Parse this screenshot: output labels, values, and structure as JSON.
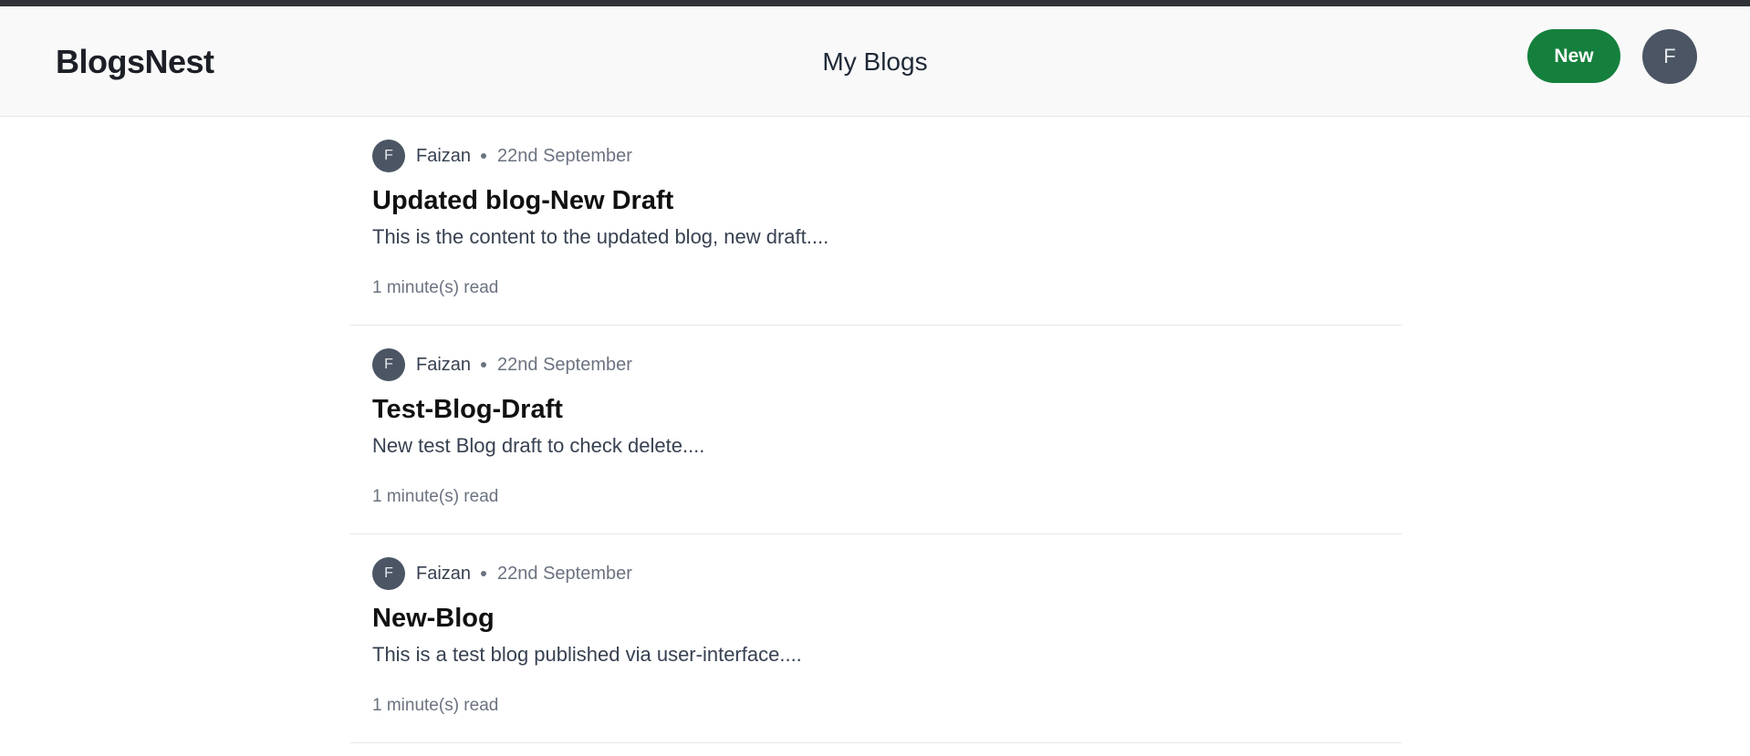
{
  "header": {
    "brand": "BlogsNest",
    "title": "My Blogs",
    "new_button_label": "New",
    "user_initial": "F"
  },
  "colors": {
    "accent_green": "#15803d",
    "avatar_gray": "#4b5563",
    "top_strip": "#2f3237"
  },
  "posts": [
    {
      "author_initial": "F",
      "author": "Faizan",
      "date": "22nd September",
      "title": "Updated blog-New Draft",
      "excerpt": "This is the content to the updated blog, new draft....",
      "read_time": "1 minute(s) read"
    },
    {
      "author_initial": "F",
      "author": "Faizan",
      "date": "22nd September",
      "title": "Test-Blog-Draft",
      "excerpt": "New test Blog draft to check delete....",
      "read_time": "1 minute(s) read"
    },
    {
      "author_initial": "F",
      "author": "Faizan",
      "date": "22nd September",
      "title": "New-Blog",
      "excerpt": "This is a test blog published via user-interface....",
      "read_time": "1 minute(s) read"
    }
  ]
}
